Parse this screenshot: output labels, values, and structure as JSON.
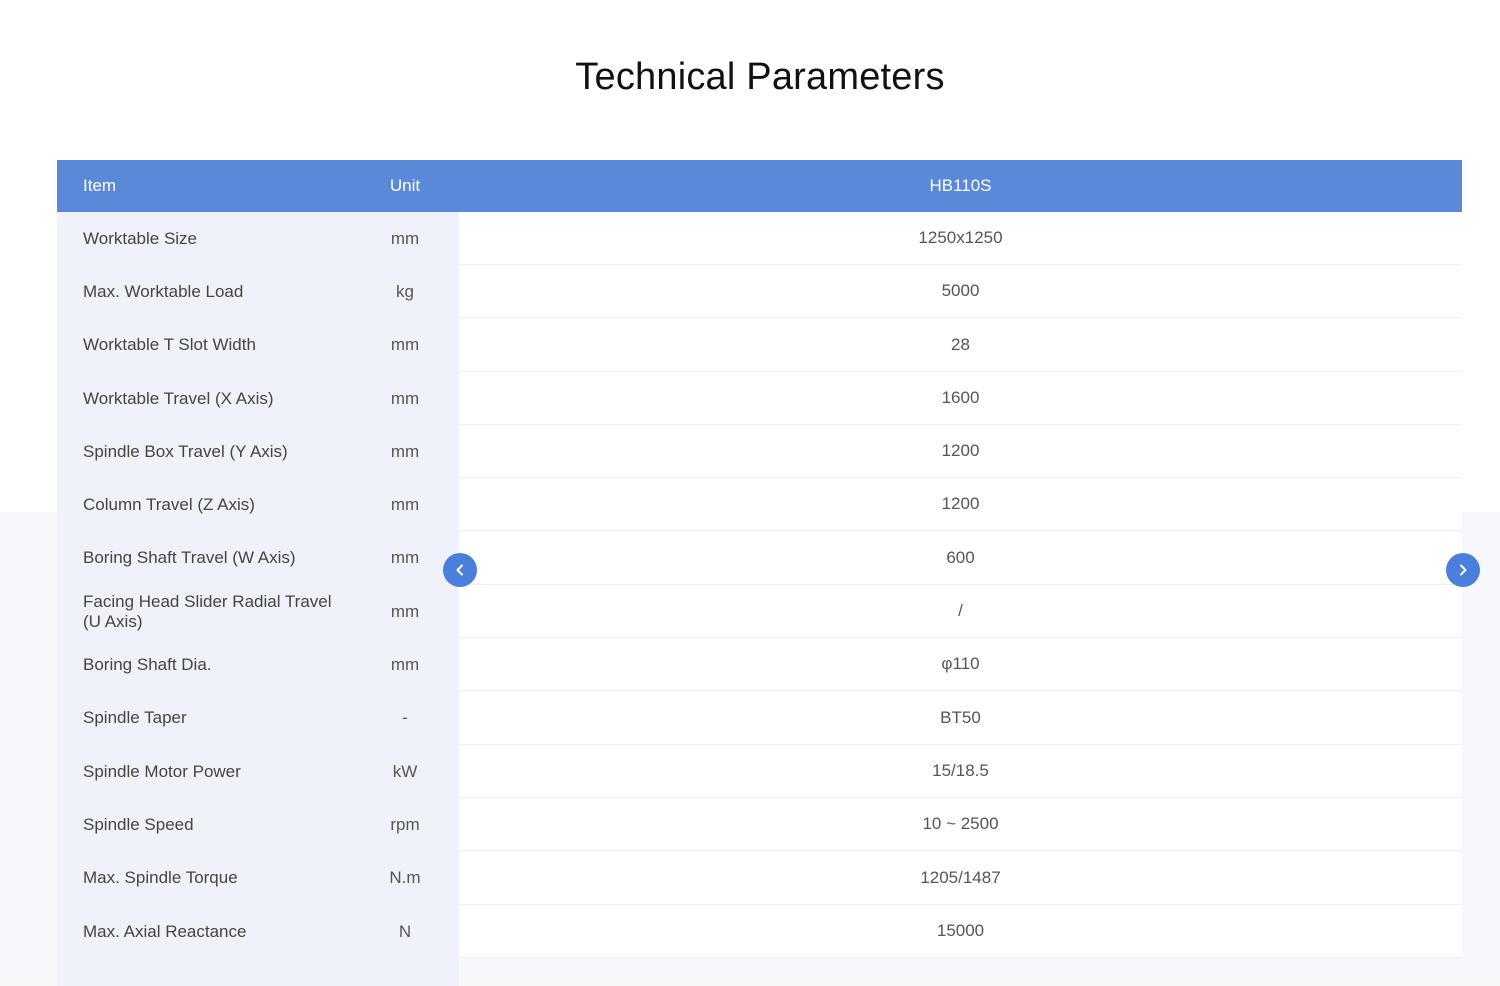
{
  "page": {
    "title": "Technical Parameters"
  },
  "table": {
    "header": {
      "item": "Item",
      "unit": "Unit",
      "model": "HB110S"
    },
    "rows": [
      {
        "item": "Worktable Size",
        "unit": "mm",
        "value": "1250x1250"
      },
      {
        "item": "Max. Worktable Load",
        "unit": "kg",
        "value": "5000"
      },
      {
        "item": "Worktable T Slot Width",
        "unit": "mm",
        "value": "28"
      },
      {
        "item": "Worktable Travel (X Axis)",
        "unit": "mm",
        "value": "1600"
      },
      {
        "item": "Spindle Box Travel (Y Axis)",
        "unit": "mm",
        "value": "1200"
      },
      {
        "item": "Column Travel (Z Axis)",
        "unit": "mm",
        "value": "1200"
      },
      {
        "item": "Boring Shaft Travel (W Axis)",
        "unit": "mm",
        "value": "600"
      },
      {
        "item": "Facing Head Slider Radial Travel (U Axis)",
        "unit": "mm",
        "value": "/"
      },
      {
        "item": "Boring Shaft Dia.",
        "unit": "mm",
        "value": "φ110"
      },
      {
        "item": "Spindle Taper",
        "unit": "-",
        "value": "BT50"
      },
      {
        "item": "Spindle Motor Power",
        "unit": "kW",
        "value": "15/18.5"
      },
      {
        "item": "Spindle Speed",
        "unit": "rpm",
        "value": "10 ~ 2500"
      },
      {
        "item": "Max. Spindle Torque",
        "unit": "N.m",
        "value": "1205/1487"
      },
      {
        "item": "Max. Axial Reactance",
        "unit": "N",
        "value": "15000"
      }
    ]
  },
  "nav": {
    "prev_icon": "chevron-left-icon",
    "next_icon": "chevron-right-icon"
  },
  "colors": {
    "header_bg": "#5b89d9",
    "nav_button": "#4a7fdc",
    "label_column_bg": "#eff3f9"
  }
}
